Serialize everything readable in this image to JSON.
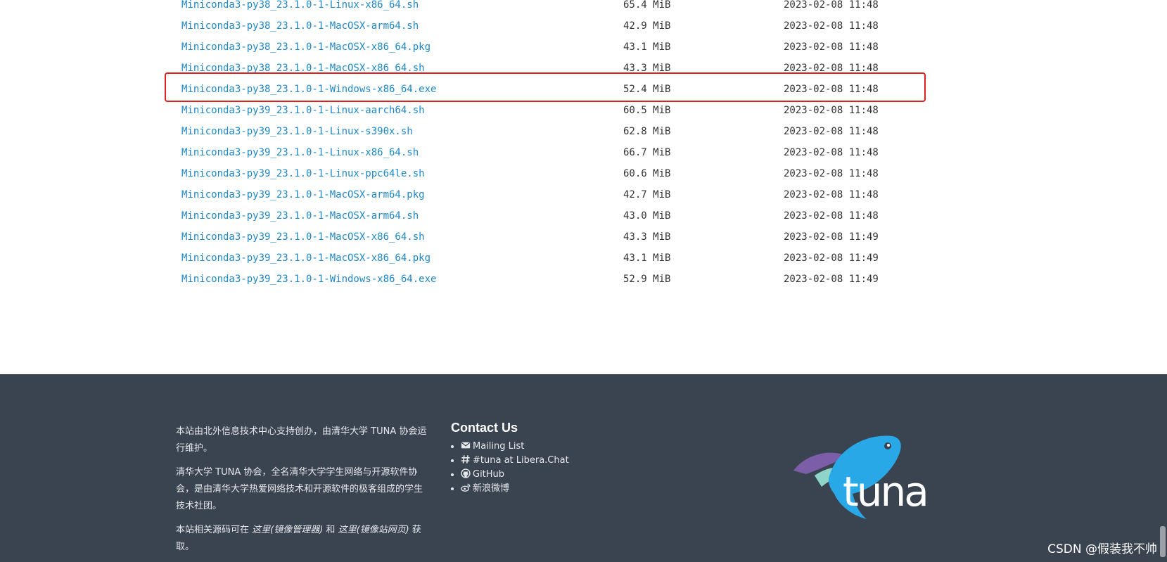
{
  "files": [
    {
      "name": "Miniconda3-py38_23.1.0-1-Linux-x86_64.sh",
      "size": "65.4 MiB",
      "date": "2023-02-08 11:48"
    },
    {
      "name": "Miniconda3-py38_23.1.0-1-MacOSX-arm64.sh",
      "size": "42.9 MiB",
      "date": "2023-02-08 11:48"
    },
    {
      "name": "Miniconda3-py38_23.1.0-1-MacOSX-x86_64.pkg",
      "size": "43.1 MiB",
      "date": "2023-02-08 11:48"
    },
    {
      "name": "Miniconda3-py38_23.1.0-1-MacOSX-x86_64.sh",
      "size": "43.3 MiB",
      "date": "2023-02-08 11:48"
    },
    {
      "name": "Miniconda3-py38_23.1.0-1-Windows-x86_64.exe",
      "size": "52.4 MiB",
      "date": "2023-02-08 11:48"
    },
    {
      "name": "Miniconda3-py39_23.1.0-1-Linux-aarch64.sh",
      "size": "60.5 MiB",
      "date": "2023-02-08 11:48"
    },
    {
      "name": "Miniconda3-py39_23.1.0-1-Linux-s390x.sh",
      "size": "62.8 MiB",
      "date": "2023-02-08 11:48"
    },
    {
      "name": "Miniconda3-py39_23.1.0-1-Linux-x86_64.sh",
      "size": "66.7 MiB",
      "date": "2023-02-08 11:48"
    },
    {
      "name": "Miniconda3-py39_23.1.0-1-Linux-ppc64le.sh",
      "size": "60.6 MiB",
      "date": "2023-02-08 11:48"
    },
    {
      "name": "Miniconda3-py39_23.1.0-1-MacOSX-arm64.pkg",
      "size": "42.7 MiB",
      "date": "2023-02-08 11:48"
    },
    {
      "name": "Miniconda3-py39_23.1.0-1-MacOSX-arm64.sh",
      "size": "43.0 MiB",
      "date": "2023-02-08 11:48"
    },
    {
      "name": "Miniconda3-py39_23.1.0-1-MacOSX-x86_64.sh",
      "size": "43.3 MiB",
      "date": "2023-02-08 11:49"
    },
    {
      "name": "Miniconda3-py39_23.1.0-1-MacOSX-x86_64.pkg",
      "size": "43.1 MiB",
      "date": "2023-02-08 11:49"
    },
    {
      "name": "Miniconda3-py39_23.1.0-1-Windows-x86_64.exe",
      "size": "52.9 MiB",
      "date": "2023-02-08 11:49"
    }
  ],
  "highlighted_file": "Miniconda3-py38_23.1.0-1-Windows-x86_64.exe",
  "footer": {
    "about_1": "本站由北外信息技术中心支持创办，由清华大学 TUNA 协会运行维护。",
    "about_2": "清华大学 TUNA 协会，全名清华大学学生网络与开源软件协会，是由清华大学热爱网络技术和开源软件的极客组成的学生技术社团。",
    "about_3_prefix": "本站相关源码可在 ",
    "about_3_link1": "这里(镜像管理器)",
    "about_3_mid": " 和 ",
    "about_3_link2": "这里(镜像站网页)",
    "about_3_suffix": " 获取。",
    "contact_title": "Contact Us",
    "contacts": [
      {
        "label": "Mailing List",
        "icon": "envelope-icon"
      },
      {
        "label": "#tuna at Libera.Chat",
        "icon": "hash-icon"
      },
      {
        "label": "GitHub",
        "icon": "github-icon"
      },
      {
        "label": "新浪微博",
        "icon": "weibo-icon"
      }
    ],
    "logo_text": "tuna"
  },
  "watermark": "CSDN @假装我不帅",
  "colors": {
    "link": "#1e88c7",
    "footer_bg": "#3a4450",
    "highlight": "#e02020",
    "tuna_blue": "#29a8e8",
    "tuna_purple": "#7b5ea7"
  }
}
